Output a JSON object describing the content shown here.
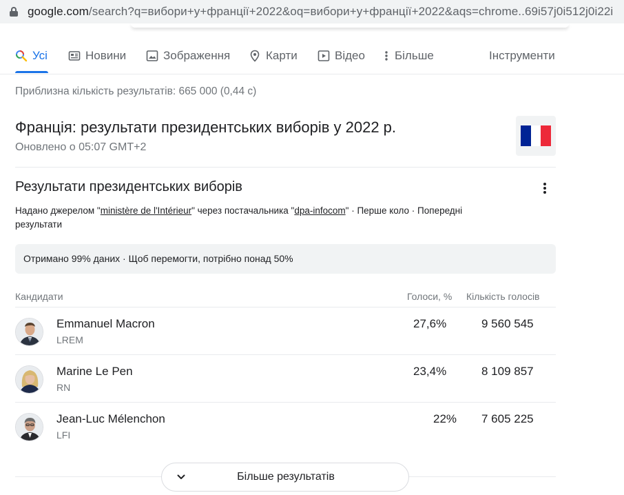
{
  "browser": {
    "url_host": "google.com",
    "url_rest": "/search?q=вибори+у+франції+2022&oq=вибори+у+франції+2022&aqs=chrome..69i57j0i512j0i22i"
  },
  "tabs": [
    {
      "label": "Усі",
      "icon": "search-icon",
      "active": true
    },
    {
      "label": "Новини",
      "icon": "news-icon"
    },
    {
      "label": "Зображення",
      "icon": "image-icon"
    },
    {
      "label": "Карти",
      "icon": "map-pin-icon"
    },
    {
      "label": "Відео",
      "icon": "video-icon"
    },
    {
      "label": "Більше",
      "icon": "more-vert-icon"
    }
  ],
  "tools_label": "Інструменти",
  "stats": "Приблизна кількість результатів: 665 000 (0,44 с)",
  "panel": {
    "title": "Франція: результати президентських виборів у 2022 р.",
    "updated": "Оновлено о 05:07 GMT+2",
    "flag_colors": [
      "#002395",
      "#ffffff",
      "#ed2939"
    ]
  },
  "results": {
    "title": "Результати президентських виборів",
    "source_prefix": "Надано джерелом \"",
    "source_name": "ministère de l'Intérieur",
    "source_mid": "\" через постачальника \"",
    "provider_name": "dpa-infocom",
    "source_suffix": "\" · Перше коло · Попередні результати",
    "notice": "Отримано 99% даних · Щоб перемогти, потрібно понад 50%",
    "headers": {
      "candidates": "Кандидати",
      "percent": "Голоси, %",
      "votes": "Кількість голосів"
    },
    "candidates": [
      {
        "name": "Emmanuel Macron",
        "party": "LREM",
        "percent": "27,6%",
        "votes": "9 560 545"
      },
      {
        "name": "Marine Le Pen",
        "party": "RN",
        "percent": "23,4%",
        "votes": "8 109 857"
      },
      {
        "name": "Jean-Luc Mélenchon",
        "party": "LFI",
        "percent": "22%",
        "votes": "7 605 225"
      }
    ],
    "more_label": "Більше результатів"
  }
}
